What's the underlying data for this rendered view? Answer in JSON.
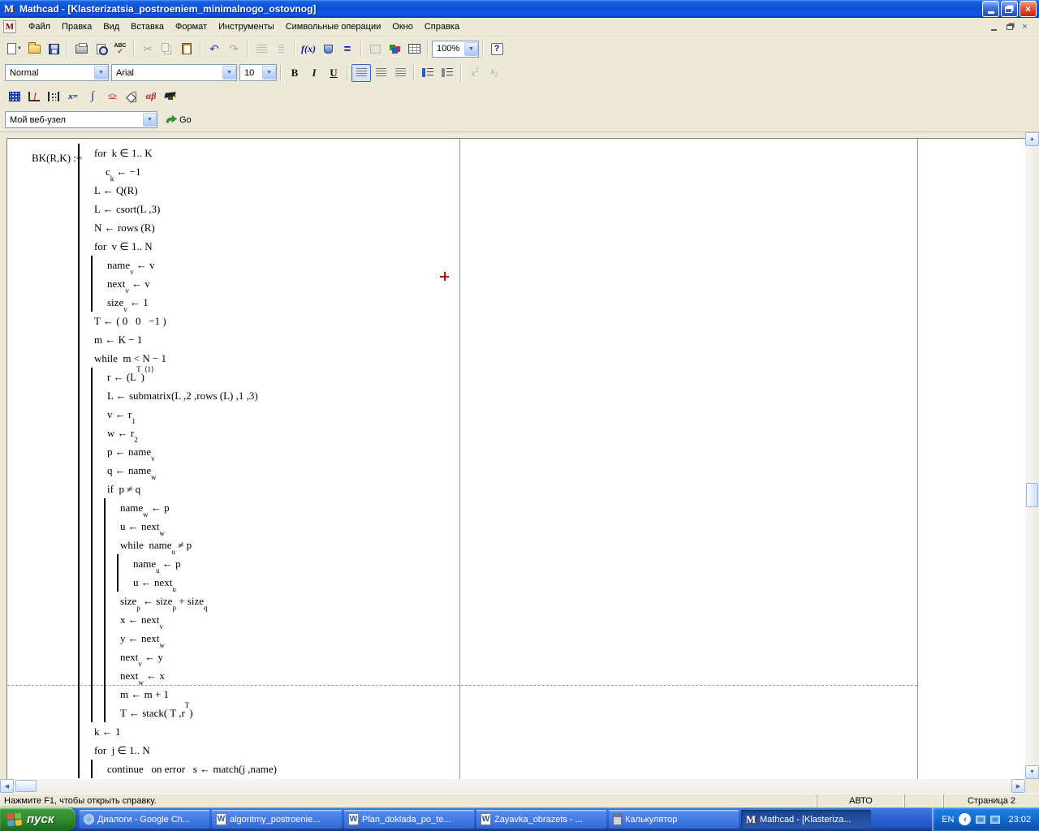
{
  "window": {
    "title": "Mathcad - [Klasterizatsia_postroeniem_minimalnogo_ostovnog]"
  },
  "menu": {
    "items": [
      "Файл",
      "Правка",
      "Вид",
      "Вставка",
      "Формат",
      "Инструменты",
      "Символьные операции",
      "Окно",
      "Справка"
    ]
  },
  "toolbar_standard": {
    "spell_label": "ABC",
    "function_label": "f(x)",
    "calculate_label": "=",
    "zoom_value": "100%",
    "help_label": "?"
  },
  "toolbar_format": {
    "style_value": "Normal",
    "font_value": "Arial",
    "size_value": "10",
    "bold": "B",
    "italic": "I",
    "underline": "U",
    "sup_base": "x",
    "sup_mark": "2",
    "sub_base": "x",
    "sub_mark": "2"
  },
  "toolbar_math": {
    "evaluation": "x=",
    "calculus": "∫",
    "boolean": "≤≥",
    "greek": "αβ"
  },
  "webbar": {
    "address_value": "Мой веб-узел",
    "go_label": "Go"
  },
  "document": {
    "definition_label": "BK(R,K) :=",
    "program_lines": [
      {
        "indent": 1,
        "pad": 0,
        "text": "for  k ∈ 1.. K"
      },
      {
        "indent": 1,
        "pad": 1,
        "text": "c_{k} ← −1"
      },
      {
        "indent": 1,
        "pad": 0,
        "text": "L ← Q(R)"
      },
      {
        "indent": 1,
        "pad": 0,
        "text": "L ← csort(L ,3)"
      },
      {
        "indent": 1,
        "pad": 0,
        "text": "N ← rows (R)"
      },
      {
        "indent": 1,
        "pad": 0,
        "text": "for  v ∈ 1.. N"
      },
      {
        "indent": 2,
        "pad": 0,
        "text": "name_{v} ← v"
      },
      {
        "indent": 2,
        "pad": 0,
        "text": "next_{v} ← v"
      },
      {
        "indent": 2,
        "pad": 0,
        "text": "size_{v} ← 1"
      },
      {
        "indent": 1,
        "pad": 0,
        "text": "T ← ( 0   0   −1 )"
      },
      {
        "indent": 1,
        "pad": 0,
        "text": "m ← K − 1"
      },
      {
        "indent": 1,
        "pad": 0,
        "text": "while  m < N − 1"
      },
      {
        "indent": 2,
        "pad": 0,
        "text": "r ← (L^{T})^{⟨1⟩}"
      },
      {
        "indent": 2,
        "pad": 0,
        "text": "L ← submatrix(L ,2 ,rows (L) ,1 ,3)"
      },
      {
        "indent": 2,
        "pad": 0,
        "text": "v ← r_{1}"
      },
      {
        "indent": 2,
        "pad": 0,
        "text": "w ← r_{2}"
      },
      {
        "indent": 2,
        "pad": 0,
        "text": "p ← name_{v}"
      },
      {
        "indent": 2,
        "pad": 0,
        "text": "q ← name_{w}"
      },
      {
        "indent": 2,
        "pad": 0,
        "text": "if  p ≠ q"
      },
      {
        "indent": 3,
        "pad": 0,
        "text": "name_{w} ← p"
      },
      {
        "indent": 3,
        "pad": 0,
        "text": "u ← next_{w}"
      },
      {
        "indent": 3,
        "pad": 0,
        "text": "while  name_{u} ≠ p"
      },
      {
        "indent": 4,
        "pad": 0,
        "text": "name_{u} ← p"
      },
      {
        "indent": 4,
        "pad": 0,
        "text": "u ← next_{u}"
      },
      {
        "indent": 3,
        "pad": 0,
        "text": "size_{p} ← size_{p} + size_{q}"
      },
      {
        "indent": 3,
        "pad": 0,
        "text": "x ← next_{v}"
      },
      {
        "indent": 3,
        "pad": 0,
        "text": "y ← next_{w}"
      },
      {
        "indent": 3,
        "pad": 0,
        "text": "next_{v} ← y"
      },
      {
        "indent": 3,
        "pad": 0,
        "text": "next_{w} ← x"
      },
      {
        "indent": 3,
        "pad": 0,
        "text": "m ← m + 1"
      },
      {
        "indent": 3,
        "pad": 0,
        "text": "T ← stack( T ,r^{T})"
      },
      {
        "indent": 1,
        "pad": 0,
        "text": "k ← 1"
      },
      {
        "indent": 1,
        "pad": 0,
        "text": "for  j ∈ 1.. N"
      },
      {
        "indent": 2,
        "pad": 0,
        "text": "continue   on error   s ← match(j ,name)"
      }
    ]
  },
  "statusbar": {
    "message": "Нажмите F1, чтобы открыть справку.",
    "mode": "АВТО",
    "page": "Страница 2"
  },
  "taskbar": {
    "start_label": "пуск",
    "tasks": [
      {
        "icon": "chrome",
        "label": "Диалоги - Google Ch...",
        "active": false
      },
      {
        "icon": "word",
        "label": "algoritmy_postroenie...",
        "active": false
      },
      {
        "icon": "word",
        "label": "Plan_doklada_po_te...",
        "active": false
      },
      {
        "icon": "word",
        "label": "Zayavka_obrazets - ...",
        "active": false
      },
      {
        "icon": "calc",
        "label": "Калькулятор",
        "active": false
      },
      {
        "icon": "mathcad",
        "label": "Mathcad - [Klasteriza...",
        "active": true
      }
    ],
    "tray": {
      "lang": "EN",
      "time": "23:02"
    }
  },
  "glyphs": {
    "close": "×",
    "app_letter": "M",
    "doc_letter": "M",
    "word_letter": "W",
    "mathcad_letter": "M",
    "cut": "✂",
    "undo": "↶",
    "redo": "↷",
    "combo_arrow": "▼",
    "new_drop": "▼",
    "scroll_up": "▲",
    "scroll_down": "▼",
    "scroll_left": "◀",
    "scroll_right": "▶",
    "chevron": "‹"
  }
}
